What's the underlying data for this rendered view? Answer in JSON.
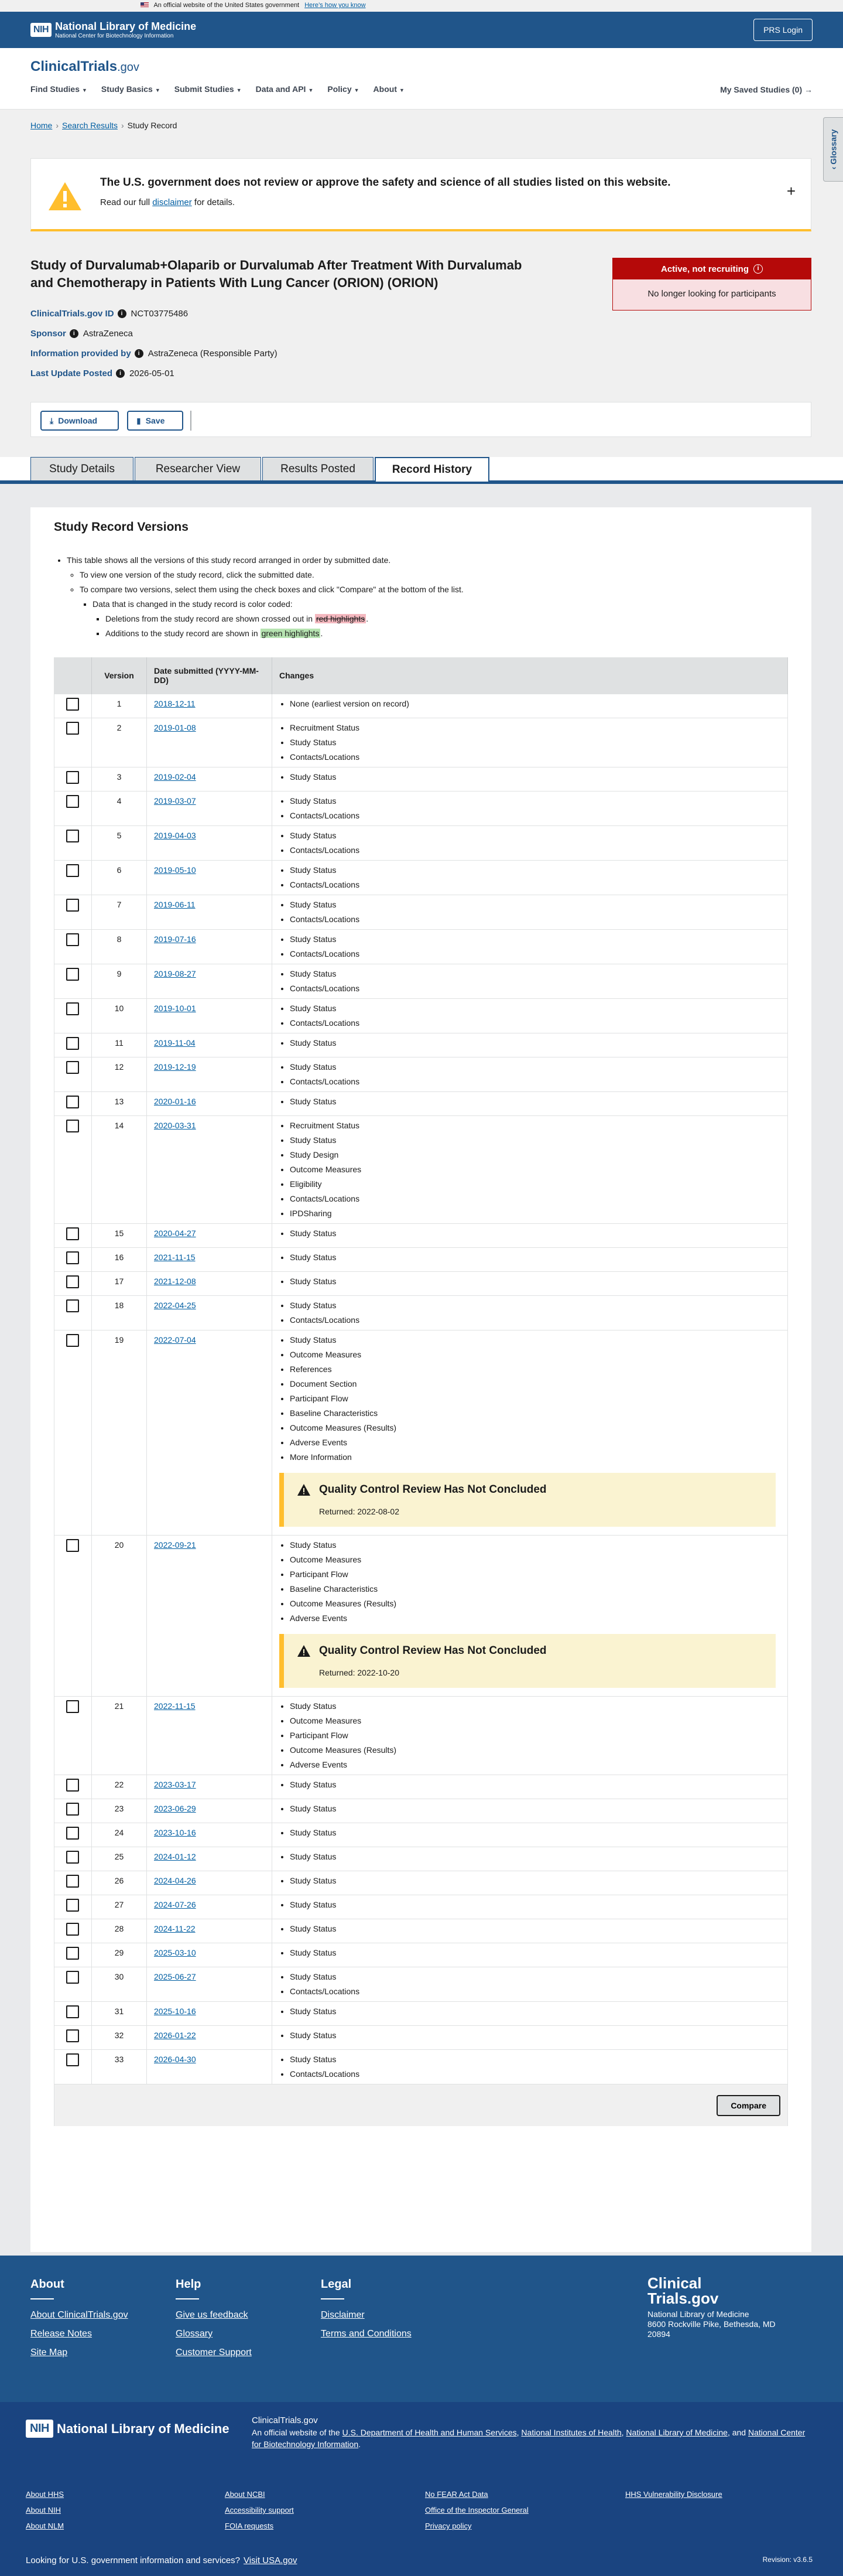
{
  "gov_banner": {
    "text": "An official website of the United States government",
    "link": "Here’s how you know"
  },
  "nlm": {
    "name": "National Library of Medicine",
    "sub": "National Center for Biotechnology Information",
    "prs_login": "PRS Login",
    "nih": "NIH"
  },
  "site": {
    "logo": "ClinicalTrials",
    "logo_suffix": ".gov"
  },
  "nav": {
    "items": [
      "Find Studies",
      "Study Basics",
      "Submit Studies",
      "Data and API",
      "Policy",
      "About"
    ],
    "saved": "My Saved Studies (0)",
    "glossary": "Glossary"
  },
  "breadcrumb": [
    "Home",
    "Search Results",
    "Study Record"
  ],
  "disclaimer": {
    "title": "The U.S. government does not review or approve the safety and science of all studies listed on this website.",
    "pre": "Read our full ",
    "link": "disclaimer",
    "post": " for details."
  },
  "study": {
    "title": "Study of Durvalumab+Olaparib or Durvalumab After Treatment With Durvalumab and Chemotherapy in Patients With Lung Cancer (ORION) (ORION)",
    "status": "Active, not recruiting",
    "status_sub": "No longer looking for participants",
    "id_label": "ClinicalTrials.gov ID",
    "id": "NCT03775486",
    "sponsor_label": "Sponsor",
    "sponsor": "AstraZeneca",
    "provided_label": "Information provided by",
    "provided": "AstraZeneca (Responsible Party)",
    "update_label": "Last Update Posted",
    "update": "2026-05-01"
  },
  "actions": {
    "download": "Download",
    "save": "Save"
  },
  "tabs": [
    "Study Details",
    "Researcher View",
    "Results Posted",
    "Record History"
  ],
  "versions": {
    "heading": "Study Record Versions",
    "intro1": "This table shows all the versions of this study record arranged in order by submitted date.",
    "intro2": "To view one version of the study record, click the submitted date.",
    "intro3": "To compare two versions, select them using the check boxes and click \"Compare\" at the bottom of the list.",
    "intro4": "Data that is changed in the study record is color coded:",
    "intro5_pre": "Deletions from the study record are shown crossed out in ",
    "intro5_hl": "red highlights",
    "intro6_pre": "Additions to the study record are shown in ",
    "intro6_hl": "green highlights",
    "headers": {
      "version": "Version",
      "date": "Date submitted (YYYY-MM-DD)",
      "changes": "Changes"
    },
    "compare": "Compare",
    "rows": [
      {
        "v": "1",
        "date": "2018-12-11",
        "changes": [
          "None (earliest version on record)"
        ]
      },
      {
        "v": "2",
        "date": "2019-01-08",
        "changes": [
          "Recruitment Status",
          "Study Status",
          "Contacts/Locations"
        ]
      },
      {
        "v": "3",
        "date": "2019-02-04",
        "changes": [
          "Study Status"
        ]
      },
      {
        "v": "4",
        "date": "2019-03-07",
        "changes": [
          "Study Status",
          "Contacts/Locations"
        ]
      },
      {
        "v": "5",
        "date": "2019-04-03",
        "changes": [
          "Study Status",
          "Contacts/Locations"
        ]
      },
      {
        "v": "6",
        "date": "2019-05-10",
        "changes": [
          "Study Status",
          "Contacts/Locations"
        ]
      },
      {
        "v": "7",
        "date": "2019-06-11",
        "changes": [
          "Study Status",
          "Contacts/Locations"
        ]
      },
      {
        "v": "8",
        "date": "2019-07-16",
        "changes": [
          "Study Status",
          "Contacts/Locations"
        ]
      },
      {
        "v": "9",
        "date": "2019-08-27",
        "changes": [
          "Study Status",
          "Contacts/Locations"
        ]
      },
      {
        "v": "10",
        "date": "2019-10-01",
        "changes": [
          "Study Status",
          "Contacts/Locations"
        ]
      },
      {
        "v": "11",
        "date": "2019-11-04",
        "changes": [
          "Study Status"
        ]
      },
      {
        "v": "12",
        "date": "2019-12-19",
        "changes": [
          "Study Status",
          "Contacts/Locations"
        ]
      },
      {
        "v": "13",
        "date": "2020-01-16",
        "changes": [
          "Study Status"
        ]
      },
      {
        "v": "14",
        "date": "2020-03-31",
        "changes": [
          "Recruitment Status",
          "Study Status",
          "Study Design",
          "Outcome Measures",
          "Eligibility",
          "Contacts/Locations",
          "IPDSharing"
        ]
      },
      {
        "v": "15",
        "date": "2020-04-27",
        "changes": [
          "Study Status"
        ]
      },
      {
        "v": "16",
        "date": "2021-11-15",
        "changes": [
          "Study Status"
        ]
      },
      {
        "v": "17",
        "date": "2021-12-08",
        "changes": [
          "Study Status"
        ]
      },
      {
        "v": "18",
        "date": "2022-04-25",
        "changes": [
          "Study Status",
          "Contacts/Locations"
        ]
      },
      {
        "v": "19",
        "date": "2022-07-04",
        "changes": [
          "Study Status",
          "Outcome Measures",
          "References",
          "Document Section",
          "Participant Flow",
          "Baseline Characteristics",
          "Outcome Measures (Results)",
          "Adverse Events",
          "More Information"
        ],
        "qc": {
          "title": "Quality Control Review Has Not Concluded",
          "returned": "Returned: 2022-08-02"
        }
      },
      {
        "v": "20",
        "date": "2022-09-21",
        "changes": [
          "Study Status",
          "Outcome Measures",
          "Participant Flow",
          "Baseline Characteristics",
          "Outcome Measures (Results)",
          "Adverse Events"
        ],
        "qc": {
          "title": "Quality Control Review Has Not Concluded",
          "returned": "Returned: 2022-10-20"
        }
      },
      {
        "v": "21",
        "date": "2022-11-15",
        "changes": [
          "Study Status",
          "Outcome Measures",
          "Participant Flow",
          "Outcome Measures (Results)",
          "Adverse Events"
        ]
      },
      {
        "v": "22",
        "date": "2023-03-17",
        "changes": [
          "Study Status"
        ]
      },
      {
        "v": "23",
        "date": "2023-06-29",
        "changes": [
          "Study Status"
        ]
      },
      {
        "v": "24",
        "date": "2023-10-16",
        "changes": [
          "Study Status"
        ]
      },
      {
        "v": "25",
        "date": "2024-01-12",
        "changes": [
          "Study Status"
        ]
      },
      {
        "v": "26",
        "date": "2024-04-26",
        "changes": [
          "Study Status"
        ]
      },
      {
        "v": "27",
        "date": "2024-07-26",
        "changes": [
          "Study Status"
        ]
      },
      {
        "v": "28",
        "date": "2024-11-22",
        "changes": [
          "Study Status"
        ]
      },
      {
        "v": "29",
        "date": "2025-03-10",
        "changes": [
          "Study Status"
        ]
      },
      {
        "v": "30",
        "date": "2025-06-27",
        "changes": [
          "Study Status",
          "Contacts/Locations"
        ]
      },
      {
        "v": "31",
        "date": "2025-10-16",
        "changes": [
          "Study Status"
        ]
      },
      {
        "v": "32",
        "date": "2026-01-22",
        "changes": [
          "Study Status"
        ]
      },
      {
        "v": "33",
        "date": "2026-04-30",
        "changes": [
          "Study Status",
          "Contacts/Locations"
        ]
      }
    ]
  },
  "footer": {
    "about": {
      "title": "About",
      "links": [
        "About ClinicalTrials.gov",
        "Release Notes",
        "Site Map"
      ]
    },
    "help": {
      "title": "Help",
      "links": [
        "Give us feedback",
        "Glossary",
        "Customer Support"
      ]
    },
    "legal": {
      "title": "Legal",
      "links": [
        "Disclaimer",
        "Terms and Conditions"
      ]
    },
    "brand": {
      "l1": "Clinical",
      "l2": "Trials.gov",
      "org": "National Library of Medicine",
      "addr": "8600 Rockville Pike, Bethesda, MD",
      "zip": "20894"
    },
    "nlm": "National Library of Medicine",
    "official_ct": "ClinicalTrials.gov",
    "official_pre": "An official website of the",
    "official_hhs": "U.S. Department of Health and Human Services",
    "official_nih": "National Institutes of Health",
    "official_nlm": "National Library of Medicine",
    "official_and": ", and",
    "official_ncbi": "National Center for Biotechnology Information",
    "col1": [
      "About HHS",
      "About NIH",
      "About NLM"
    ],
    "col2": [
      "About NCBI",
      "Accessibility support",
      "FOIA requests"
    ],
    "col3": [
      "No FEAR Act Data",
      "Office of the Inspector General",
      "Privacy policy"
    ],
    "col4": [
      "HHS Vulnerability Disclosure"
    ],
    "visit_text": "Looking for U.S. government information and services?",
    "visit_link": "Visit USA.gov",
    "revision": "Revision: v3.6.5"
  }
}
